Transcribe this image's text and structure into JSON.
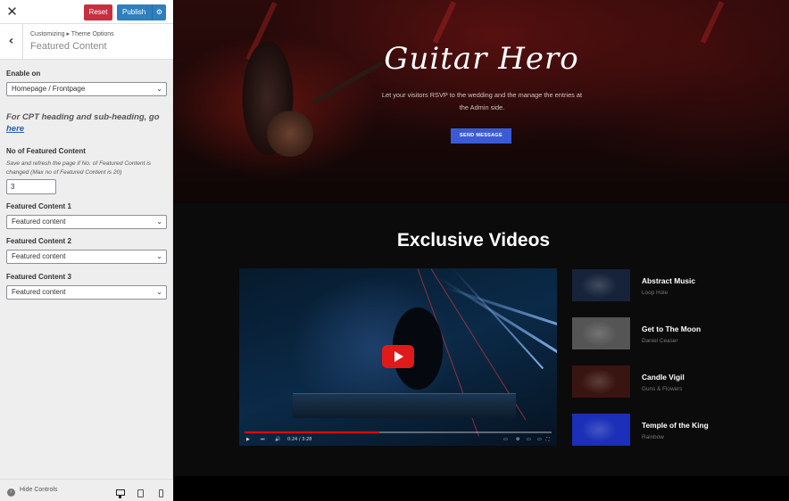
{
  "topbar": {
    "close_label": "✕",
    "reset_label": "Reset",
    "publish_label": "Publish",
    "publish_gear": "⚙"
  },
  "section": {
    "back_label": "‹",
    "breadcrumb": "Customizing ▸ Theme Options",
    "title": "Featured Content"
  },
  "fields": {
    "enable_on_label": "Enable on",
    "enable_on_value": "Homepage / Frontpage",
    "cpt_note": "For CPT heading and sub-heading, go",
    "cpt_link": "here",
    "num_label": "No of Featured Content",
    "num_desc": "Save and refresh the page if No. of Featured Content is changed (Max no of Featured Content is 20)",
    "num_value": "3",
    "fc1_label": "Featured Content 1",
    "fc1_value": "Featured content",
    "fc2_label": "Featured Content 2",
    "fc2_value": "Featured content",
    "fc3_label": "Featured Content 3",
    "fc3_value": "Featured content",
    "chevron": "⌄"
  },
  "footer": {
    "hide_label": "Hide Controls",
    "hide_glyph": "‹"
  },
  "hero": {
    "title": "Guitar Hero",
    "subtitle": "Let your visitors RSVP to the wedding and the manage the entries at the Admin side.",
    "button": "SEND MESSAGE"
  },
  "videos": {
    "title": "Exclusive Videos",
    "player": {
      "time": "0:24 / 3:28",
      "progress": 0.44,
      "icons": {
        "play": "▶",
        "next": "⏭",
        "volume": "🔊",
        "cc": "▭",
        "settings": "⚙",
        "miniplayer": "▭",
        "theater": "▭",
        "fullscreen": "⛶"
      }
    },
    "items": [
      {
        "title": "Abstract Music",
        "artist": "Loop Hole",
        "thumb_color": "#17233a"
      },
      {
        "title": "Get to The Moon",
        "artist": "Daniel Ceaser",
        "thumb_color": "#555555"
      },
      {
        "title": "Candle Vigil",
        "artist": "Guns & Flowers",
        "thumb_color": "#3a1410"
      },
      {
        "title": "Temple of the King",
        "artist": "Rainbow",
        "thumb_color": "#1b2fb8"
      }
    ]
  },
  "colors": {
    "reset": "#c6303e",
    "publish": "#2f7fbe",
    "hero_button": "#3b5bd6",
    "play_button": "#e01a1a",
    "link": "#2b5fa8"
  }
}
